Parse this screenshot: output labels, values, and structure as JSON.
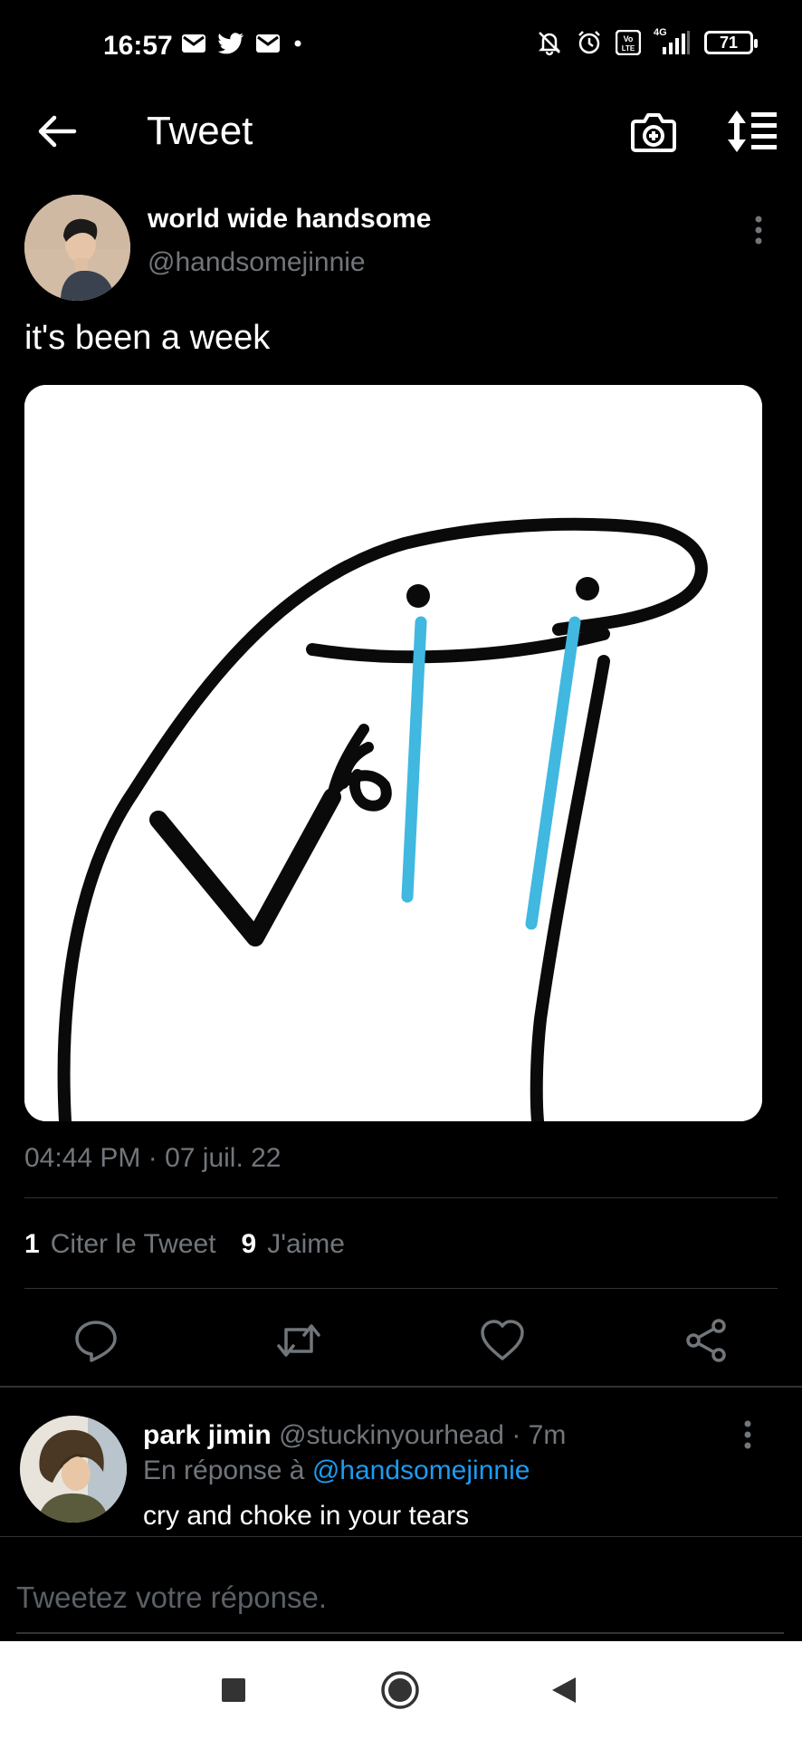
{
  "status_bar": {
    "time": "16:57",
    "battery": "71",
    "network": "4G"
  },
  "top_bar": {
    "title": "Tweet"
  },
  "tweet": {
    "author_name": "world wide handsome",
    "author_handle": "@handsomejinnie",
    "text": "it's been a week",
    "timestamp": "04:44 PM · 07 juil. 22",
    "quote_count": "1",
    "quote_label": "Citer le Tweet",
    "like_count": "9",
    "like_label": "J'aime"
  },
  "reply": {
    "author_name": "park jimin",
    "author_handle": "@stuckinyourhead",
    "time": "· 7m",
    "in_reply_prefix": "En réponse à",
    "in_reply_mention": "@handsomejinnie",
    "text": "cry and choke in your tears"
  },
  "compose": {
    "placeholder": "Tweetez votre réponse."
  },
  "colors": {
    "background": "#000000",
    "accent": "#1d9bf0",
    "secondary_text": "#71767b",
    "divider": "#2f3336",
    "tear": "#40b8e0"
  }
}
